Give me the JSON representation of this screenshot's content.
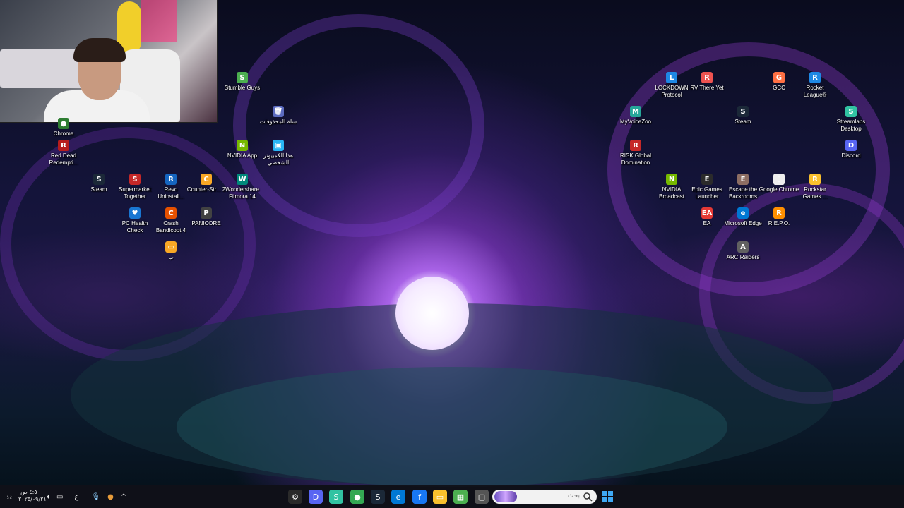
{
  "desktop": {
    "icons": [
      {
        "label": "Chrome",
        "glyph": "●",
        "color": "#2e7d32"
      },
      {
        "label": "Red Dead Redempti...",
        "glyph": "R",
        "color": "#b71c1c"
      },
      {
        "label": "Steam",
        "glyph": "S",
        "color": "#1b2838"
      },
      {
        "label": "Supermarket Together",
        "glyph": "S",
        "color": "#c62828"
      },
      {
        "label": "Revo Uninstall...",
        "glyph": "R",
        "color": "#1565c0"
      },
      {
        "label": "Counter-Str... 2",
        "glyph": "C",
        "color": "#f9a825"
      },
      {
        "label": "Wondershare Filmora 14",
        "glyph": "W",
        "color": "#00897b"
      },
      {
        "label": "PC Health Check",
        "glyph": "♥",
        "color": "#1976d2"
      },
      {
        "label": "Crash Bandicoot 4",
        "glyph": "C",
        "color": "#e65100"
      },
      {
        "label": "PANICORE",
        "glyph": "P",
        "color": "#424242"
      },
      {
        "label": "ب",
        "glyph": "▭",
        "color": "#f9a825"
      },
      {
        "label": "Stumble Guys",
        "glyph": "S",
        "color": "#4caf50"
      },
      {
        "label": "سلة المحذوفات",
        "glyph": "🗑",
        "color": "#5c6bc0"
      },
      {
        "label": "NVIDIA App",
        "glyph": "N",
        "color": "#76b900"
      },
      {
        "label": "هذا الكمبيوتر الشخصي",
        "glyph": "▣",
        "color": "#29b6f6"
      },
      {
        "label": "LOCKDOWN Protocol",
        "glyph": "L",
        "color": "#1e88e5"
      },
      {
        "label": "RV There Yet",
        "glyph": "R",
        "color": "#ef5350"
      },
      {
        "label": "GCC",
        "glyph": "G",
        "color": "#ff7043"
      },
      {
        "label": "Rocket League®",
        "glyph": "R",
        "color": "#1e88e5"
      },
      {
        "label": "MyVoiceZoo",
        "glyph": "M",
        "color": "#26a69a"
      },
      {
        "label": "Steam",
        "glyph": "S",
        "color": "#1b2838"
      },
      {
        "label": "Streamlabs Desktop",
        "glyph": "S",
        "color": "#31c3a2"
      },
      {
        "label": "RISK Global Domination",
        "glyph": "R",
        "color": "#c62828"
      },
      {
        "label": "Discord",
        "glyph": "D",
        "color": "#5865f2"
      },
      {
        "label": "NVIDIA Broadcast",
        "glyph": "N",
        "color": "#76b900"
      },
      {
        "label": "Epic Games Launcher",
        "glyph": "E",
        "color": "#2b2b2b"
      },
      {
        "label": "Escape the Backrooms",
        "glyph": "E",
        "color": "#8d6e63"
      },
      {
        "label": "Google Chrome",
        "glyph": "▯",
        "color": "#eeeeee"
      },
      {
        "label": "Rockstar Games ...",
        "glyph": "R",
        "color": "#fbc02d"
      },
      {
        "label": "EA",
        "glyph": "EA",
        "color": "#e53935"
      },
      {
        "label": "Microsoft Edge",
        "glyph": "e",
        "color": "#0078d4"
      },
      {
        "label": "R.E.P.O.",
        "glyph": "R",
        "color": "#ff8f00"
      },
      {
        "label": "ARC Raiders",
        "glyph": "A",
        "color": "#616161"
      }
    ]
  },
  "taskbar": {
    "search_placeholder": "بحث",
    "apps": [
      {
        "name": "settings",
        "glyph": "⚙",
        "color": "#2a2a2a"
      },
      {
        "name": "discord",
        "glyph": "D",
        "color": "#5865f2"
      },
      {
        "name": "streamlabs",
        "glyph": "S",
        "color": "#31c3a2"
      },
      {
        "name": "chrome",
        "glyph": "●",
        "color": "#34a853"
      },
      {
        "name": "steam",
        "glyph": "S",
        "color": "#1b2838"
      },
      {
        "name": "edge",
        "glyph": "e",
        "color": "#0078d4"
      },
      {
        "name": "facebook",
        "glyph": "f",
        "color": "#1877f2"
      },
      {
        "name": "file-explorer",
        "glyph": "▭",
        "color": "#f9c02d"
      },
      {
        "name": "minecraft",
        "glyph": "▦",
        "color": "#4caf50"
      },
      {
        "name": "task-view",
        "glyph": "▢",
        "color": "#555555"
      }
    ],
    "tray": {
      "chevron": "^",
      "lang": "ع",
      "clock_time": "٤:٥٠ ص",
      "clock_date": "٢٠٢٥/٠٩/٢١"
    }
  }
}
